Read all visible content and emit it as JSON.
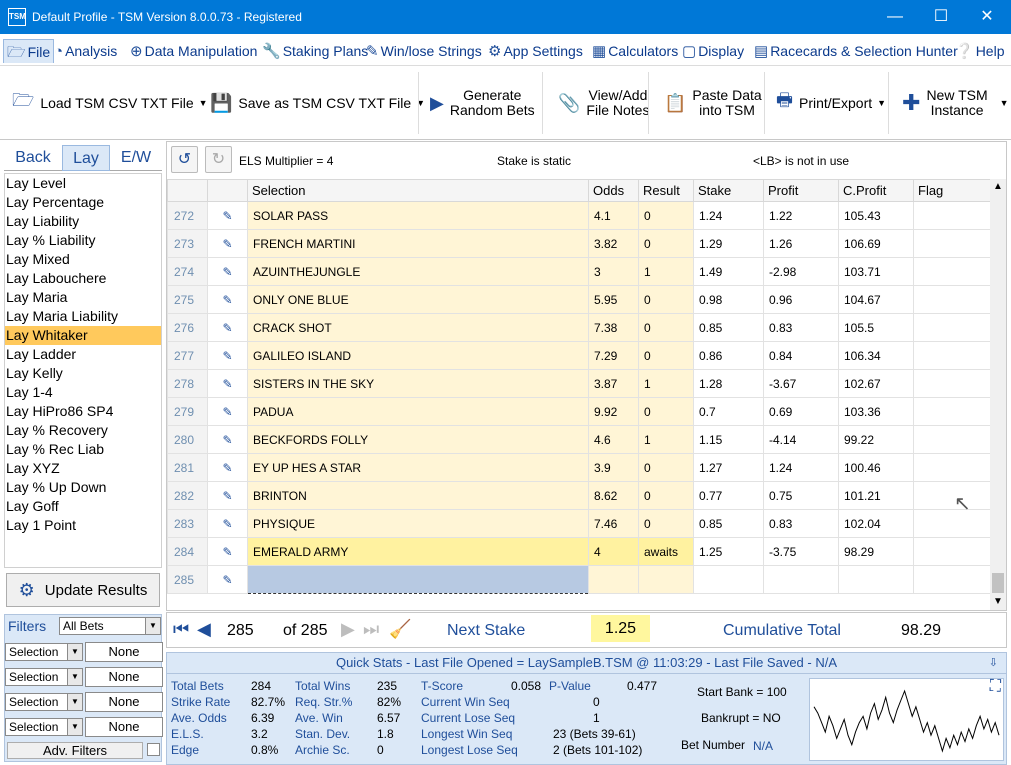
{
  "window": {
    "icon_text": "TSM",
    "title": "Default Profile  -  TSM Version 8.0.0.73 - Registered"
  },
  "menu": [
    "File",
    "Analysis",
    "Data Manipulation",
    "Staking Plans",
    "Win/lose Strings",
    "App Settings",
    "Calculators",
    "Display",
    "Racecards & Selection Hunter",
    "Help"
  ],
  "ribbon": {
    "load": "Load TSM CSV TXT File",
    "save": "Save as TSM CSV TXT File",
    "gen1": "Generate",
    "gen2": "Random Bets",
    "view1": "View/Add",
    "view2": "File Notes",
    "paste1": "Paste Data",
    "paste2": "into TSM",
    "print": "Print/Export",
    "new1": "New TSM",
    "new2": "Instance"
  },
  "tabs": [
    "Back",
    "Lay",
    "E/W"
  ],
  "strategies": [
    "Lay Level",
    "Lay Percentage",
    "Lay Liability",
    "Lay % Liability",
    "Lay Mixed",
    "Lay Labouchere",
    "Lay Maria",
    "Lay Maria Liability",
    "Lay Whitaker",
    "Lay Ladder",
    "Lay Kelly",
    "Lay 1-4",
    "Lay HiPro86 SP4",
    "Lay % Recovery",
    "Lay % Rec Liab",
    "Lay XYZ",
    "Lay % Up Down",
    "Lay Goff",
    "Lay 1 Point"
  ],
  "selected_strategy": "Lay Whitaker",
  "update_label": "Update Results",
  "filters": {
    "label": "Filters",
    "bets": "All Bets",
    "rows": [
      {
        "field": "Selection",
        "value": "None"
      },
      {
        "field": "Selection",
        "value": "None"
      },
      {
        "field": "Selection",
        "value": "None"
      },
      {
        "field": "Selection",
        "value": "None"
      }
    ],
    "adv": "Adv. Filters"
  },
  "grid_toolbar": {
    "els": "ELS Multiplier = 4",
    "stake": "Stake is static",
    "lb": "<LB> is not in use"
  },
  "columns": [
    "Selection",
    "Odds",
    "Result",
    "Stake",
    "Profit",
    "C.Profit",
    "Flag"
  ],
  "rows": [
    {
      "n": "272",
      "sel": "SOLAR PASS",
      "odds": "4.1",
      "res": "0",
      "stake": "1.24",
      "profit": "1.22",
      "cp": "105.43"
    },
    {
      "n": "273",
      "sel": "FRENCH MARTINI",
      "odds": "3.82",
      "res": "0",
      "stake": "1.29",
      "profit": "1.26",
      "cp": "106.69"
    },
    {
      "n": "274",
      "sel": "AZUINTHEJUNGLE",
      "odds": "3",
      "res": "1",
      "stake": "1.49",
      "profit": "-2.98",
      "cp": "103.71"
    },
    {
      "n": "275",
      "sel": "ONLY ONE BLUE",
      "odds": "5.95",
      "res": "0",
      "stake": "0.98",
      "profit": "0.96",
      "cp": "104.67"
    },
    {
      "n": "276",
      "sel": "CRACK SHOT",
      "odds": "7.38",
      "res": "0",
      "stake": "0.85",
      "profit": "0.83",
      "cp": "105.5"
    },
    {
      "n": "277",
      "sel": "GALILEO ISLAND",
      "odds": "7.29",
      "res": "0",
      "stake": "0.86",
      "profit": "0.84",
      "cp": "106.34"
    },
    {
      "n": "278",
      "sel": "SISTERS IN THE SKY",
      "odds": "3.87",
      "res": "1",
      "stake": "1.28",
      "profit": "-3.67",
      "cp": "102.67"
    },
    {
      "n": "279",
      "sel": "PADUA",
      "odds": "9.92",
      "res": "0",
      "stake": "0.7",
      "profit": "0.69",
      "cp": "103.36"
    },
    {
      "n": "280",
      "sel": "BECKFORDS FOLLY",
      "odds": "4.6",
      "res": "1",
      "stake": "1.15",
      "profit": "-4.14",
      "cp": "99.22"
    },
    {
      "n": "281",
      "sel": "EY UP HES A STAR",
      "odds": "3.9",
      "res": "0",
      "stake": "1.27",
      "profit": "1.24",
      "cp": "100.46"
    },
    {
      "n": "282",
      "sel": "BRINTON",
      "odds": "8.62",
      "res": "0",
      "stake": "0.77",
      "profit": "0.75",
      "cp": "101.21"
    },
    {
      "n": "283",
      "sel": "PHYSIQUE",
      "odds": "7.46",
      "res": "0",
      "stake": "0.85",
      "profit": "0.83",
      "cp": "102.04"
    },
    {
      "n": "284",
      "sel": "EMERALD ARMY",
      "odds": "4",
      "res": "awaits",
      "stake": "1.25",
      "profit": "-3.75",
      "cp": "98.29"
    },
    {
      "n": "285",
      "sel": "",
      "odds": "",
      "res": "",
      "stake": "",
      "profit": "",
      "cp": ""
    }
  ],
  "nav": {
    "current": "285",
    "of": "of 285",
    "next_stake_label": "Next Stake",
    "next_stake": "1.25",
    "cum_label": "Cumulative Total",
    "cum": "98.29"
  },
  "quickstats": {
    "title": "Quick Stats - Last File Opened = LaySampleB.TSM @ 11:03:29 - Last File Saved - N/A",
    "col1": [
      [
        "Total Bets",
        "284"
      ],
      [
        "Strike Rate",
        "82.7%"
      ],
      [
        "Ave. Odds",
        "6.39"
      ],
      [
        "E.L.S.",
        "3.2"
      ],
      [
        "Edge",
        "0.8%"
      ]
    ],
    "col2": [
      [
        "Total Wins",
        "235"
      ],
      [
        "Req. Str.%",
        "82%"
      ],
      [
        "Ave. Win",
        "6.57"
      ],
      [
        "Stan. Dev.",
        "1.8"
      ],
      [
        "Archie Sc.",
        "0"
      ]
    ],
    "col3": [
      [
        "T-Score",
        "0.058"
      ],
      [
        "Current Win Seq",
        "0"
      ],
      [
        "Current Lose Seq",
        "1"
      ],
      [
        "Longest Win Seq",
        "23  (Bets 39-61)"
      ],
      [
        "Longest Lose Seq",
        "2  (Bets 101-102)"
      ]
    ],
    "pvalue_label": "P-Value",
    "pvalue": "0.477",
    "start_bank": "Start Bank = 100",
    "bankrupt": "Bankrupt = NO",
    "bet_number_label": "Bet Number",
    "bet_number": "N/A"
  },
  "sparkline": [
    0,
    -2,
    -5,
    -8,
    -3,
    -6,
    -10,
    -7,
    -4,
    -9,
    -12,
    -8,
    -5,
    -3,
    -7,
    -2,
    1,
    -4,
    -1,
    3,
    -2,
    -5,
    -1,
    2,
    5,
    1,
    -3,
    0,
    -4,
    -8,
    -5,
    -9,
    -6,
    -10,
    -14,
    -10,
    -13,
    -9,
    -12,
    -8,
    -11,
    -7,
    -10,
    -6,
    -3,
    -7,
    -4,
    -8,
    -5,
    -9
  ]
}
